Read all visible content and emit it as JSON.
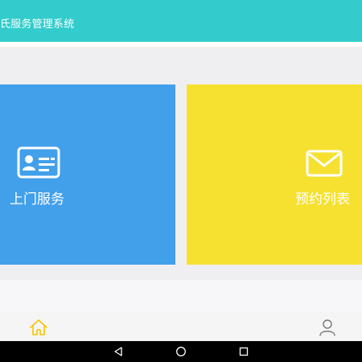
{
  "app": {
    "title": "氏服务管理系统",
    "accent_color": "#33cccc"
  },
  "tiles": [
    {
      "label": "上门服务",
      "icon": "id-card-icon",
      "color": "#42a0eb"
    },
    {
      "label": "预约列表",
      "icon": "envelope-icon",
      "color": "#f6e131"
    }
  ],
  "tab_bar": {
    "items": [
      {
        "icon": "home-icon",
        "active": true,
        "active_color": "#f5c400"
      },
      {
        "icon": "user-icon",
        "active": false
      }
    ]
  },
  "system_nav": {
    "buttons": [
      "back-icon",
      "home-circle-icon",
      "recent-apps-icon"
    ]
  }
}
